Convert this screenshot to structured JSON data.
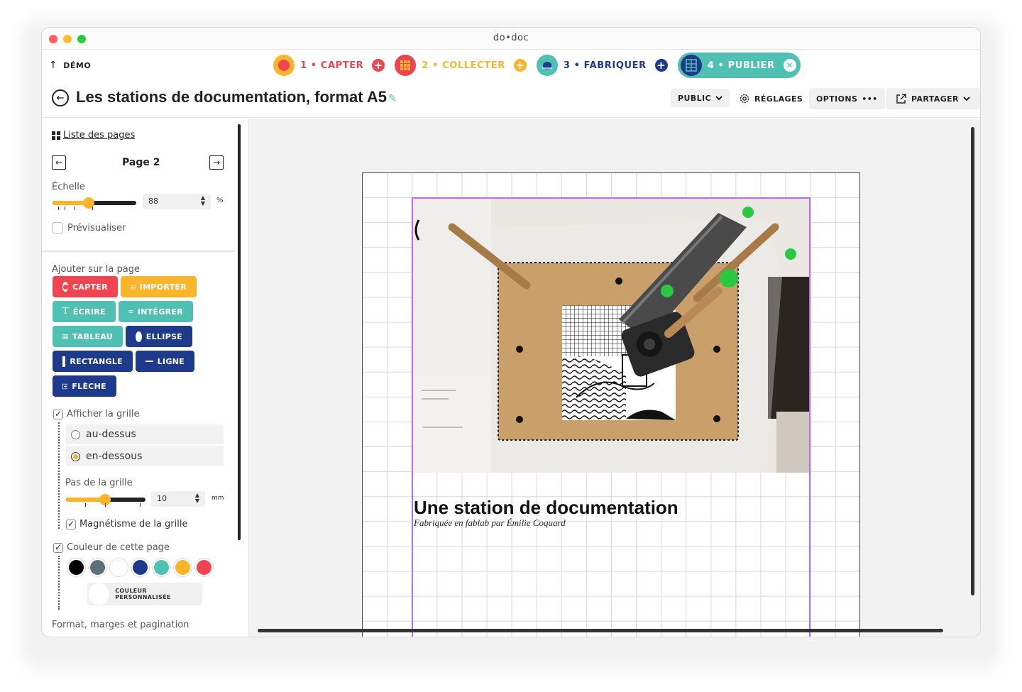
{
  "window": {
    "title": "do•doc"
  },
  "nav": {
    "up_label": "DÉMO",
    "steps": [
      {
        "label": "1 • CAPTER",
        "color": "#ef4552"
      },
      {
        "label": "2 • COLLECTER",
        "color": "#fbb52a"
      },
      {
        "label": "3 • FABRIQUER",
        "color": "#1e3a8a"
      },
      {
        "label": "4 • PUBLIER",
        "color": "#4fc0b2"
      }
    ]
  },
  "header": {
    "title": "Les stations de documentation, format A5",
    "visibility": "PUBLIC",
    "settings": "RÉGLAGES",
    "options": "OPTIONS",
    "options_dots": "•••",
    "share": "PARTAGER"
  },
  "sidebar": {
    "pages_link": "Liste des pages",
    "page_label": "Page 2",
    "scale_label": "Échelle",
    "scale_value": "88",
    "scale_fraction": 0.43,
    "scale_unit": "%",
    "preview_label": "Prévisualiser",
    "add_label": "Ajouter sur la page",
    "add_buttons": {
      "capter": "CAPTER",
      "importer": "IMPORTER",
      "ecrire": "ÉCRIRE",
      "integrer": "INTÉGRER",
      "tableau": "TABLEAU",
      "ellipse": "ELLIPSE",
      "rectangle": "RECTANGLE",
      "ligne": "LIGNE",
      "fleche": "FLÈCHE"
    },
    "show_grid_label": "Afficher la grille",
    "grid_above": "au-dessus",
    "grid_below": "en-dessous",
    "grid_step_label": "Pas de la grille",
    "grid_step_value": "10",
    "grid_step_fraction": 0.49,
    "grid_step_unit": "mm",
    "snap_label": "Magnétisme de la grille",
    "page_color_label": "Couleur de cette page",
    "swatches": [
      "#000000",
      "#5f7178",
      "#ffffff",
      "#1e3a8a",
      "#4fc0b2",
      "#fbb52a",
      "#ef4552"
    ],
    "custom_color_label": "COULEUR PERSONNALISÉE",
    "format_label": "Format, marges et pagination"
  },
  "canvas": {
    "title": "Une station de documentation",
    "subtitle": "Fabriquée en fablab par Émilie Coquard"
  }
}
